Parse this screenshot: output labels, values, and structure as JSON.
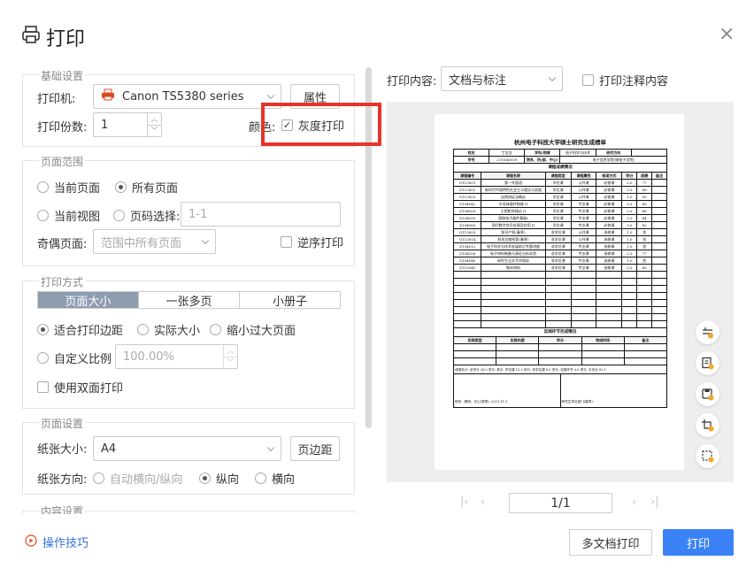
{
  "dialog": {
    "title": "打印",
    "close": "×"
  },
  "basic": {
    "legend": "基础设置",
    "printer_label": "打印机:",
    "printer_value": "Canon TS5380 series",
    "properties_button": "属性",
    "copies_label": "打印份数:",
    "copies_value": "1",
    "color_label": "颜色:",
    "grayscale_label": "灰度打印",
    "grayscale_checked": true
  },
  "range": {
    "legend": "页面范围",
    "current_page": "当前页面",
    "all_pages": "所有页面",
    "current_view": "当前视图",
    "page_select": "页码选择:",
    "page_select_placeholder": "1-1",
    "odd_even_label": "奇偶页面:",
    "odd_even_value": "范围中所有页面",
    "reverse_label": "逆序打印"
  },
  "method": {
    "legend": "打印方式",
    "tabs": [
      "页面大小",
      "一张多页",
      "小册子"
    ],
    "fit_margins": "适合打印边距",
    "actual_size": "实际大小",
    "shrink_oversized": "缩小过大页面",
    "custom_scale": "自定义比例",
    "custom_scale_value": "100.00%",
    "duplex_label": "使用双面打印"
  },
  "page_setup": {
    "legend": "页面设置",
    "paper_size_label": "纸张大小:",
    "paper_size_value": "A4",
    "margins_button": "页边距",
    "orientation_label": "纸张方向:",
    "auto_orientation": "自动横向/纵向",
    "portrait": "纵向",
    "landscape": "横向"
  },
  "content_settings": {
    "legend": "内容设置"
  },
  "print_content": {
    "label": "打印内容:",
    "value": "文档与标注",
    "annotations_label": "打印注释内容"
  },
  "document": {
    "title": "杭州电子科技大学硕士研究生成绩单",
    "header_row1": [
      "姓名",
      "丁志文",
      "学科/领域",
      "电子科学与技术",
      "研究方向",
      ""
    ],
    "header_row2": [
      "学号",
      "211040039",
      "院系、所(部、中心)",
      "电子信息学院(微电子学院)"
    ],
    "section_title": "课程成绩情况",
    "col_headers": [
      "课程编号",
      "课程名称",
      "课程类型",
      "课程属性",
      "修读方式",
      "学分",
      "成绩",
      "备注"
    ],
    "rows": [
      [
        "G113001",
        "第一外国语",
        "学位课",
        "公共课",
        "必修课",
        "3.0",
        "77",
        ""
      ],
      [
        "G113002",
        "新时代中国特色社会主义理论与实践",
        "学位课",
        "公共课",
        "必修课",
        "2.0",
        "88",
        ""
      ],
      [
        "G113003",
        "自然辩证法概论",
        "学位课",
        "公共课",
        "必修课",
        "1.0",
        "90",
        ""
      ],
      [
        "Z104042",
        "半导体器件物理 II",
        "学位课",
        "专业课",
        "必修课",
        "3.0",
        "85",
        ""
      ],
      [
        "Z104009",
        "工程矩阵理论 II",
        "学位课",
        "专业课",
        "必修课",
        "2.0",
        "86",
        ""
      ],
      [
        "Z104059",
        "固体电子器件基础I",
        "学位课",
        "专业课",
        "必修课",
        "3.0",
        "84",
        ""
      ],
      [
        "Z104060",
        "现代数字信号处理及应用 II",
        "学位课",
        "专业课",
        "必修课",
        "3.0",
        "82",
        ""
      ],
      [
        "G113005",
        "知识产权(春季)",
        "非学位课",
        "公共课",
        "选修课",
        "1.0",
        "良",
        ""
      ],
      [
        "G113014",
        "科技文献检索(春季)",
        "非学位课",
        "公共课",
        "选修课",
        "1.0",
        "良",
        ""
      ],
      [
        "Z104012",
        "电子科学与技术发展前沿专题讲座",
        "非学位课",
        "专业课",
        "选修课",
        "1.0",
        "良",
        ""
      ],
      [
        "Z104056",
        "电子材料制备与表征分析实验",
        "非学位课",
        "专业课",
        "选修课",
        "2.0",
        "77",
        ""
      ],
      [
        "Z104046",
        "研究生论文写作指导",
        "非学位课",
        "专业课",
        "选修课",
        "1.0",
        "良",
        ""
      ],
      [
        "Z113040",
        "微米材料",
        "非学位课",
        "专业课",
        "选修课",
        "2.0",
        "80",
        ""
      ]
    ],
    "section2_title": "实践环节完成情况",
    "section2_headers": [
      "实践类型",
      "实践内容",
      "学分",
      "完成时间",
      "备注"
    ],
    "summary": "成绩总计: 总学分 28.0 学分, 其中: 学位课 15.0 学分, 非学位课 8.0 学分, 实践环节 0.0 学分, 平均分 82.1",
    "footer_left": "院系、教研、中心(签章): 2021.11.5",
    "footer_right": "研究生学位部门(盖章):"
  },
  "pager": {
    "value": "1/1",
    "first": "|‹",
    "prev": "‹",
    "next": "›",
    "last": "›|"
  },
  "footer": {
    "tips_label": "操作技巧",
    "multi_doc_button": "多文档打印",
    "print_button": "打印"
  },
  "icons": [
    "printer-icon",
    "close-icon",
    "zoom-fit-icon",
    "page-save-icon",
    "save-icon",
    "crop-icon",
    "select-region-icon",
    "play-circle-icon"
  ],
  "colors": {
    "primary": "#3b82f6",
    "highlight": "#e8332a",
    "tab_active": "#8e9cb0",
    "link": "#3a6fd8"
  }
}
